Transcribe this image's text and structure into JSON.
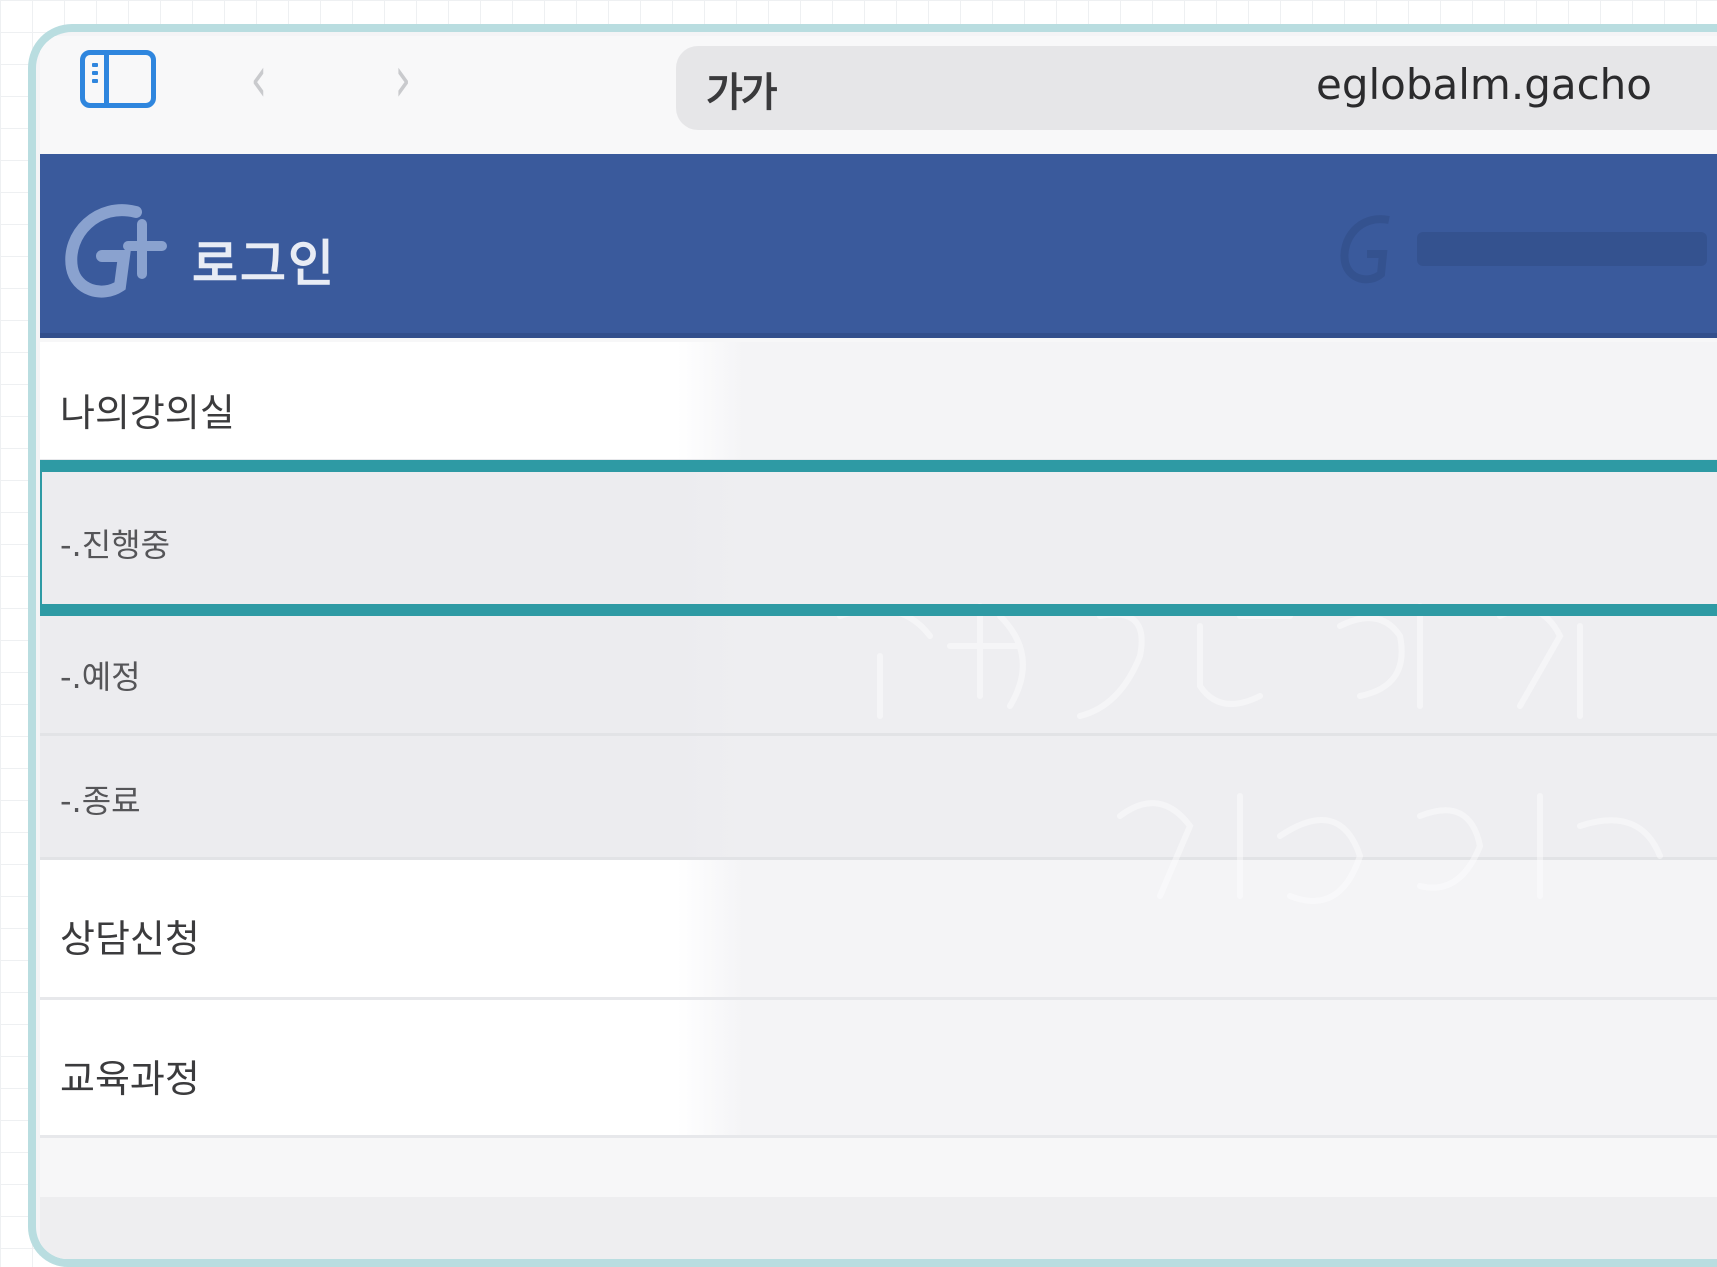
{
  "browser": {
    "text_size_label": "가가",
    "url": "eglobalm.gacho"
  },
  "header": {
    "title": "로그인"
  },
  "menu": {
    "items": [
      {
        "label": "나의강의실",
        "level": "main"
      },
      {
        "label": "-.진행중",
        "level": "sub",
        "highlighted": true
      },
      {
        "label": "-.예정",
        "level": "sub"
      },
      {
        "label": "-.종료",
        "level": "sub"
      },
      {
        "label": "상담신청",
        "level": "main"
      },
      {
        "label": "교육과정",
        "level": "main"
      }
    ]
  },
  "colors": {
    "header_bg": "#3a5a9c",
    "highlight_border": "#2e9aa4",
    "device_frame": "#b9dde0",
    "toolbar_icon": "#2f86de"
  }
}
